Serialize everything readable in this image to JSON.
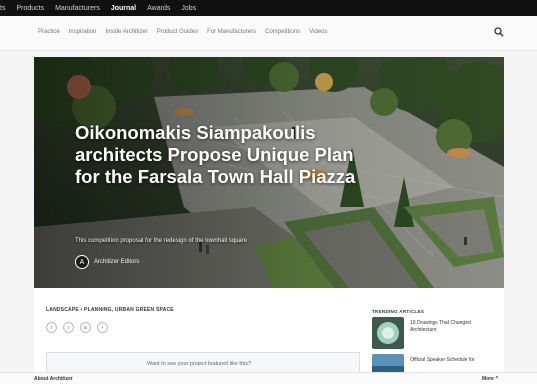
{
  "topnav": {
    "items": [
      "ts",
      "Products",
      "Manufacturers",
      "Journal",
      "Awards",
      "Jobs"
    ],
    "active": "Journal"
  },
  "subnav": {
    "items": [
      "Practice",
      "Inspiration",
      "Inside Architizer",
      "Product Guides",
      "For Manufacturers",
      "Competitions",
      "Videos"
    ]
  },
  "search": {
    "icon": "search-icon"
  },
  "hero": {
    "title": "Oikonomakis Siampakoulis architects Propose Unique Plan for the Farsala Town Hall Piazza",
    "subtitle": "This competition proposal for the redesign of the townhall square",
    "author": {
      "initial": "A",
      "name": "Architizer Editors"
    }
  },
  "article": {
    "tags": "LANDSCAPE • PLANNING, URBAN GREEN SPACE",
    "share_icons": [
      "f",
      "t",
      "in",
      "+"
    ],
    "promo": "Want to see your project featured like this?"
  },
  "trending": {
    "title": "TRENDING ARTICLES",
    "items": [
      {
        "label": "10 Drawings That Changed Architecture"
      },
      {
        "label": "Official Speaker Schedule for"
      }
    ]
  },
  "footer": {
    "about": "About Architizer",
    "more": "More ^"
  }
}
